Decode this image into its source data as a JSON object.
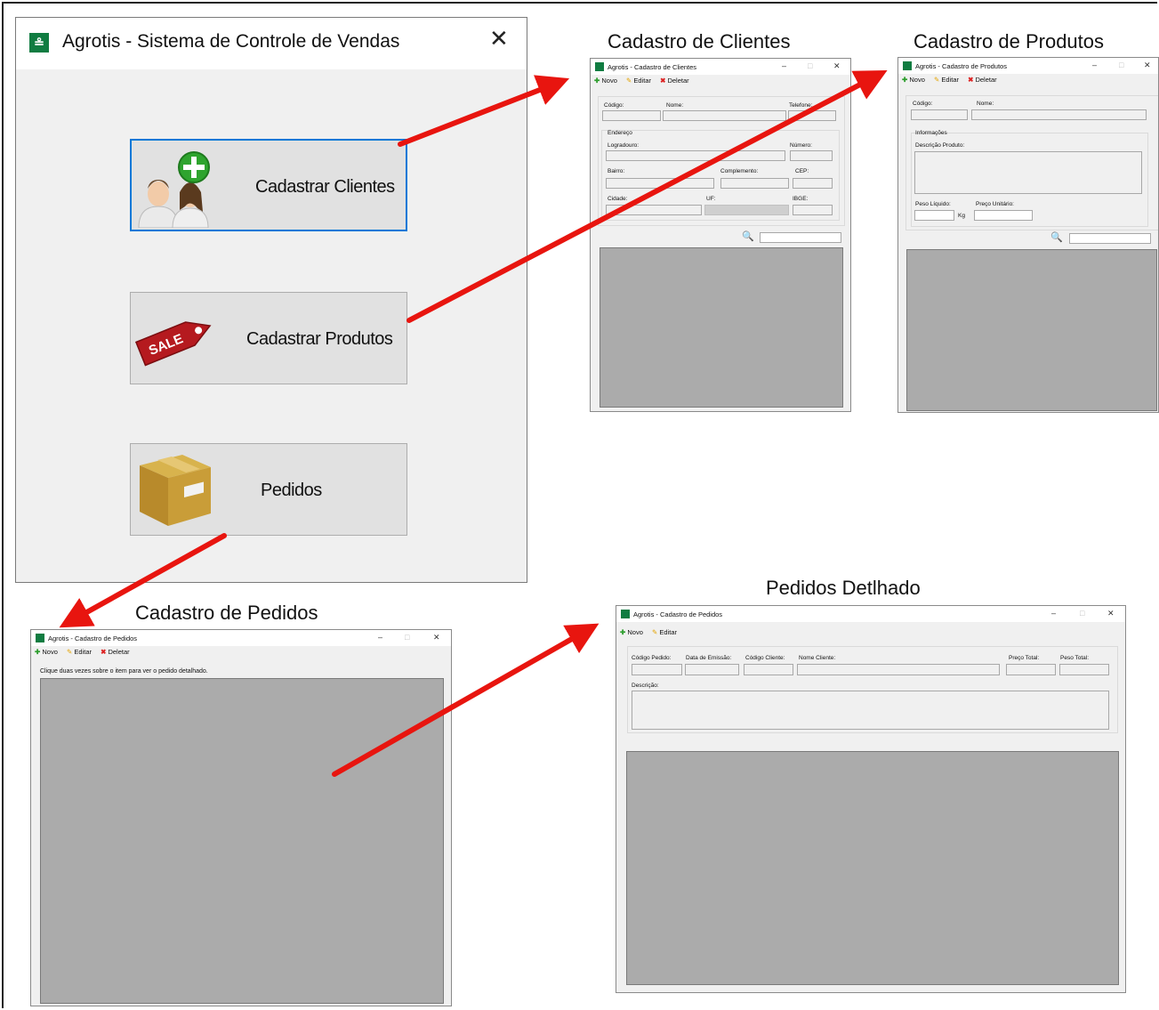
{
  "captions": {
    "clientes": "Cadastro de Clientes",
    "produtos": "Cadastro de Produtos",
    "pedidos": "Cadastro de Pedidos",
    "detalhado": "Pedidos Detlhado"
  },
  "main_window": {
    "title": "Agrotis - Sistema de Controle de Vendas",
    "close_glyph": "✕",
    "buttons": {
      "clientes": "Cadastrar Clientes",
      "produtos": "Cadastrar Produtos",
      "pedidos": "Pedidos"
    },
    "sale_tag_text": "SALE"
  },
  "window_controls": {
    "minimize": "–",
    "maximize": "□",
    "close": "✕"
  },
  "toolbar": {
    "novo": "Novo",
    "editar": "Editar",
    "deletar": "Deletar",
    "icons": {
      "novo": "plus-icon",
      "editar": "pencil-icon",
      "deletar": "x-icon"
    }
  },
  "clientes_window": {
    "title": "Agrotis - Cadastro de Clientes",
    "labels": {
      "codigo": "Código:",
      "nome": "Nome:",
      "telefone": "Telefone:",
      "endereco": "Endereço",
      "logradouro": "Logradouro:",
      "numero": "Número:",
      "bairro": "Bairro:",
      "complemento": "Complemento:",
      "cep": "CEP:",
      "cidade": "Cidade:",
      "uf": "UF:",
      "ibge": "IBGE:"
    }
  },
  "produtos_window": {
    "title": "Agrotis - Cadastro de Produtos",
    "labels": {
      "codigo": "Código:",
      "nome": "Nome:",
      "informacoes": "Informações",
      "descricao": "Descrição Produto:",
      "peso": "Peso Líquido:",
      "kg": "Kg",
      "preco": "Preço Unitário:"
    }
  },
  "pedidos_window": {
    "title": "Agrotis - Cadastro de Pedidos",
    "hint": "Clique duas vezes sobre o item para ver o pedido detalhado."
  },
  "detalhado_window": {
    "title": "Agrotis - Cadastro de Pedidos",
    "labels": {
      "codigo_pedido": "Código Pedido:",
      "data_emissao": "Data de Emissão:",
      "codigo_cliente": "Código Cliente:",
      "nome_cliente": "Nome Cliente:",
      "preco_total": "Preço Total:",
      "peso_total": "Peso Total:",
      "descricao": "Descrição:"
    }
  },
  "colors": {
    "arrow": "#e8150f",
    "selection_border": "#0078d7",
    "grid": "#ababab",
    "app_logo": "#107c41"
  }
}
